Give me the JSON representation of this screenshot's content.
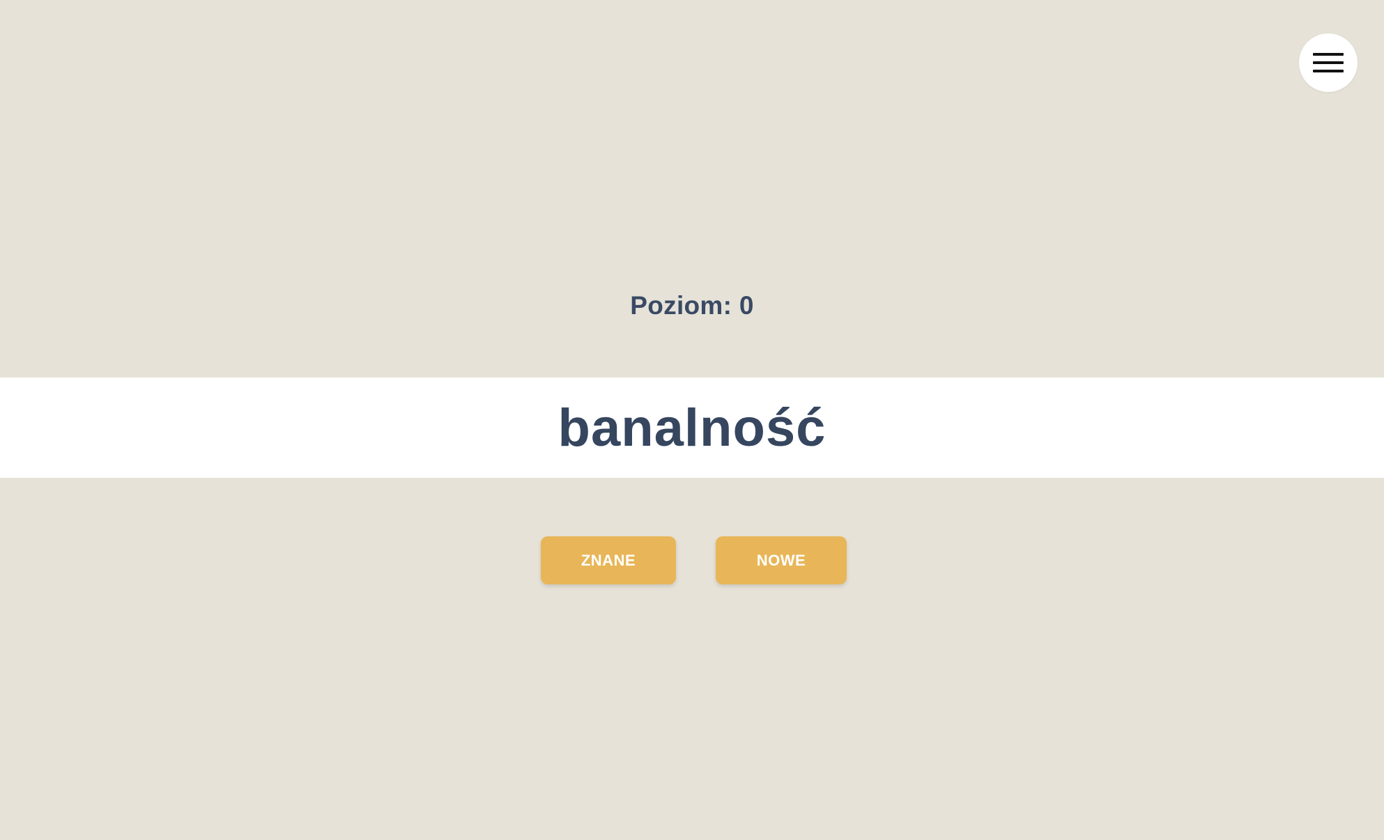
{
  "menu": {
    "icon": "hamburger-menu-icon"
  },
  "level": {
    "label": "Poziom: 0"
  },
  "word": {
    "text": "banalność"
  },
  "actions": {
    "known_label": "ZNANE",
    "new_label": "NOWE"
  },
  "colors": {
    "background": "#e6e2d8",
    "band": "#ffffff",
    "text": "#3a4a64",
    "button": "#e8b658",
    "button_text": "#ffffff"
  }
}
